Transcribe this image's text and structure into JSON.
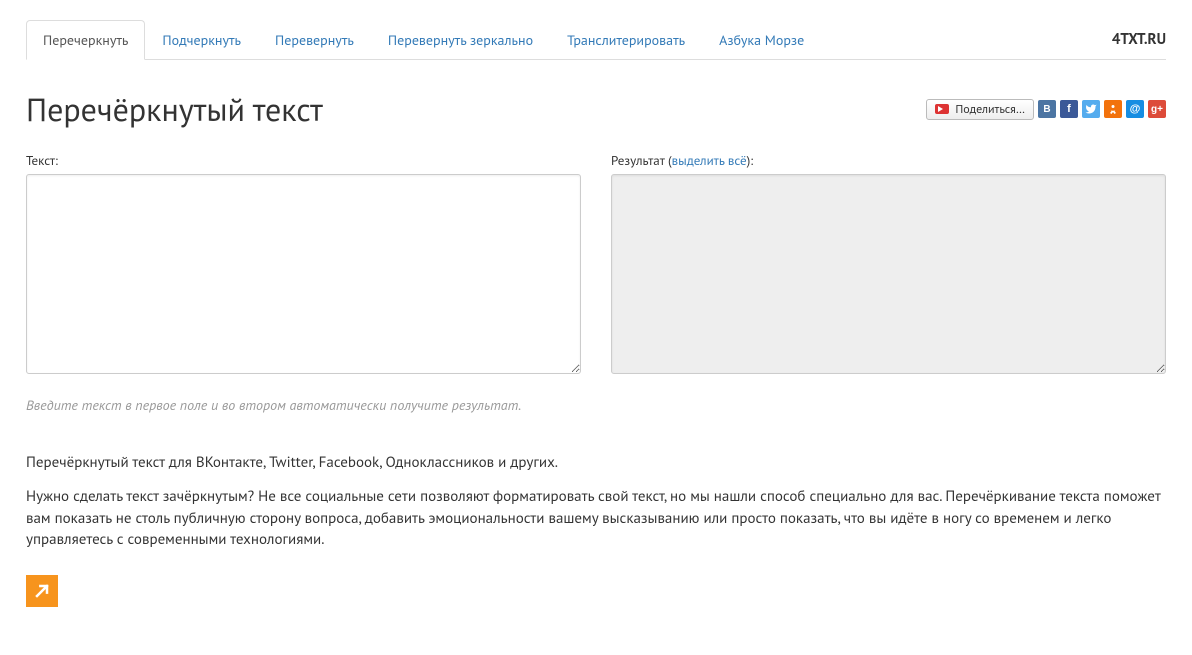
{
  "brand": "4TXT.RU",
  "tabs": [
    {
      "label": "Перечеркнуть",
      "active": true
    },
    {
      "label": "Подчеркнуть",
      "active": false
    },
    {
      "label": "Перевернуть",
      "active": false
    },
    {
      "label": "Перевернуть зеркально",
      "active": false
    },
    {
      "label": "Транслитерировать",
      "active": false
    },
    {
      "label": "Азбука Морзе",
      "active": false
    }
  ],
  "page_title": "Перечёркнутый текст",
  "share": {
    "button_label": "Поделиться…",
    "networks": [
      "vk",
      "fb",
      "tw",
      "ok",
      "mr",
      "gp"
    ]
  },
  "input": {
    "label": "Текст:",
    "value": ""
  },
  "output": {
    "label_prefix": "Результат (",
    "select_all": "выделить всё",
    "label_suffix": "):",
    "value": ""
  },
  "hint": "Введите текст в первое поле и во втором автоматически получите результат.",
  "description": {
    "p1": "Перечёркнутый текст для ВКонтакте, Twitter, Facebook, Одноклассников и других.",
    "p2": "Нужно сделать текст зачёркнутым? Не все социальные сети позволяют форматировать свой текст, но мы нашли способ специально для вас. Перечёркивание текста поможет вам показать не столь публичную сторону вопроса, добавить эмоциональности вашему высказыванию или просто показать, что вы идёте в ногу со временем и легко управляетесь с современными технологиями."
  }
}
